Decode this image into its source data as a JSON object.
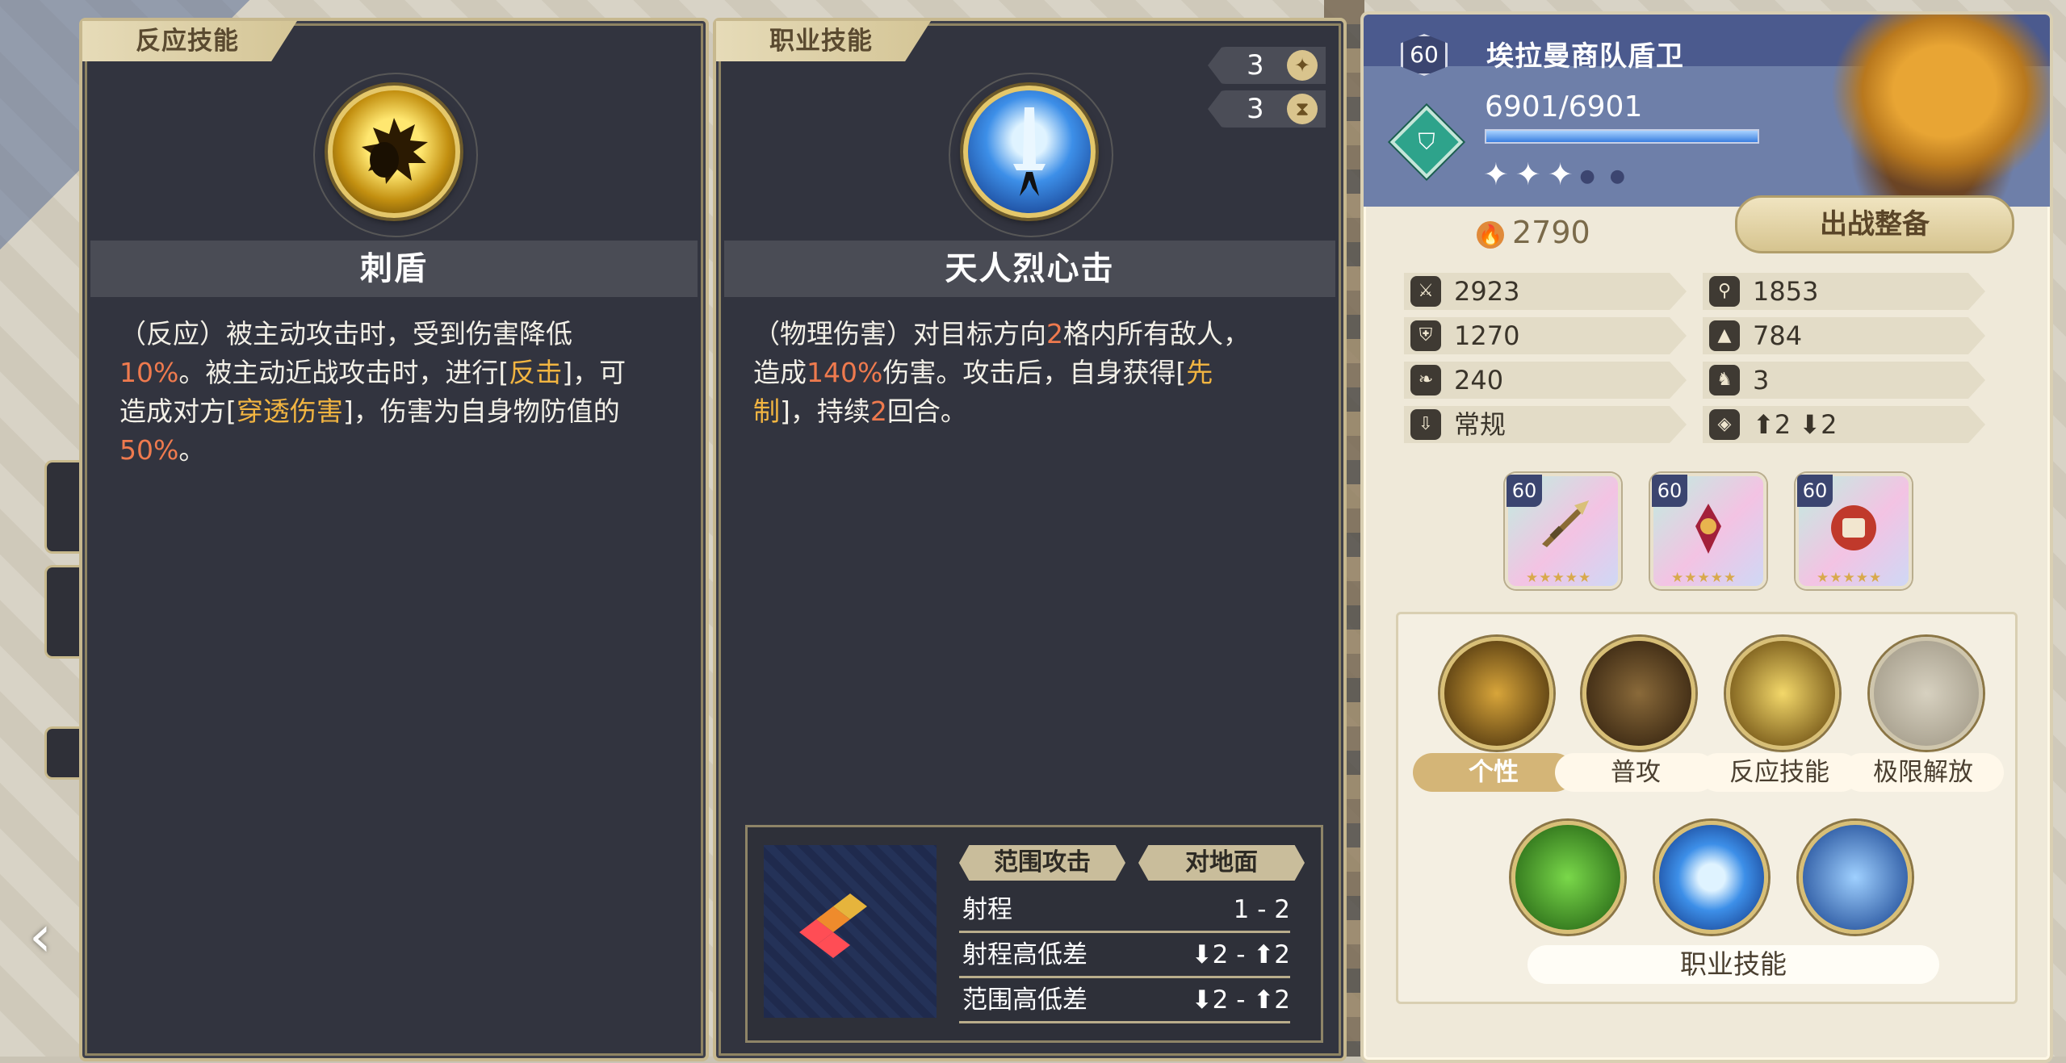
{
  "reaction_panel": {
    "tag": "反应技能",
    "skill_name": "刺盾",
    "desc": [
      [
        {
          "t": "（反应）被主动攻击时，受到伤害降低",
          "c": ""
        }
      ],
      [
        {
          "t": "10%",
          "c": "r"
        },
        {
          "t": "。被主动近战攻击时，进行[",
          "c": ""
        },
        {
          "t": "反击",
          "c": "y"
        },
        {
          "t": "]，可",
          "c": ""
        }
      ],
      [
        {
          "t": "造成对方[",
          "c": ""
        },
        {
          "t": "穿透伤害",
          "c": "y"
        },
        {
          "t": "]，伤害为自身物防值的",
          "c": ""
        }
      ],
      [
        {
          "t": "50%",
          "c": "r"
        },
        {
          "t": "。",
          "c": ""
        }
      ]
    ],
    "icon": "spiked-shield-fist-icon"
  },
  "class_panel": {
    "tag": "职业技能",
    "skill_name": "天人烈心击",
    "cost_value": "3",
    "cooldown_value": "3",
    "desc": [
      [
        {
          "t": "（物理伤害）对目标方向",
          "c": ""
        },
        {
          "t": "2",
          "c": "r"
        },
        {
          "t": "格内所有敌人，",
          "c": ""
        }
      ],
      [
        {
          "t": "造成",
          "c": ""
        },
        {
          "t": "140%",
          "c": "r"
        },
        {
          "t": "伤害。攻击后，自身获得[",
          "c": ""
        },
        {
          "t": "先",
          "c": "y"
        }
      ],
      [
        {
          "t": "制",
          "c": "y"
        },
        {
          "t": "]，持续",
          "c": ""
        },
        {
          "t": "2",
          "c": "r"
        },
        {
          "t": "回合。",
          "c": ""
        }
      ]
    ],
    "tags": [
      "范围攻击",
      "对地面"
    ],
    "range_rows": [
      {
        "key": "射程",
        "value": "1 - 2"
      },
      {
        "key": "射程高低差",
        "value": "⬇2 - ⬆2"
      },
      {
        "key": "范围高低差",
        "value": "⬇2 - ⬆2"
      }
    ],
    "icon": "blue-sword-strike-icon"
  },
  "character": {
    "level": "60",
    "name": "埃拉曼商队盾卫",
    "hp": "6901/6901",
    "hp_fraction": 1.0,
    "stars_filled": 3,
    "stars_total": 5,
    "power": "2790",
    "deploy_label": "出战整备",
    "stats": [
      {
        "icon": "sword-icon",
        "value": "2923"
      },
      {
        "icon": "magic-staff-icon",
        "value": "1853"
      },
      {
        "icon": "shield-icon",
        "value": "1270"
      },
      {
        "icon": "wizard-hat-icon",
        "value": "784"
      },
      {
        "icon": "wing-icon",
        "value": "240"
      },
      {
        "icon": "boot-icon",
        "value": "3"
      },
      {
        "icon": "movement-type-icon",
        "value": "常规"
      },
      {
        "icon": "height-icon",
        "value": "⬆2 ⬇2"
      }
    ],
    "gear": [
      {
        "level": "60",
        "icon": "spear-weapon-icon"
      },
      {
        "level": "60",
        "icon": "amulet-icon"
      },
      {
        "level": "60",
        "icon": "scroll-charm-icon"
      }
    ],
    "skill_labels": [
      "个性",
      "普攻",
      "反应技能",
      "极限解放"
    ],
    "class_skill_label": "职业技能"
  },
  "colors": {
    "panel_bg": "#32343f",
    "accent_red": "#ef7a4e",
    "accent_yellow": "#f2b541",
    "gold_border": "#c7b88e"
  }
}
